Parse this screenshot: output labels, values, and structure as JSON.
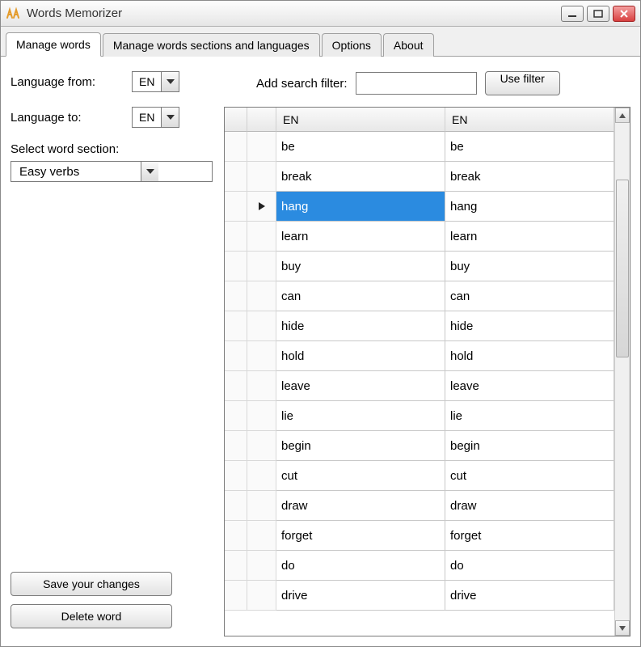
{
  "window": {
    "title": "Words Memorizer"
  },
  "tabs": [
    {
      "label": "Manage words",
      "active": true
    },
    {
      "label": "Manage words sections and languages",
      "active": false
    },
    {
      "label": "Options",
      "active": false
    },
    {
      "label": "About",
      "active": false
    }
  ],
  "left": {
    "language_from_label": "Language from:",
    "language_from_value": "EN",
    "language_to_label": "Language to:",
    "language_to_value": "EN",
    "select_section_label": "Select word section:",
    "section_value": "Easy verbs",
    "save_btn": "Save your changes",
    "delete_btn": "Delete word"
  },
  "filter": {
    "label": "Add search filter:",
    "value": "",
    "use_btn": "Use filter"
  },
  "table": {
    "col_a": "EN",
    "col_b": "EN",
    "selected_index": 2,
    "rows": [
      {
        "a": "be",
        "b": "be"
      },
      {
        "a": "break",
        "b": "break"
      },
      {
        "a": "hang",
        "b": "hang"
      },
      {
        "a": "learn",
        "b": "learn"
      },
      {
        "a": "buy",
        "b": "buy"
      },
      {
        "a": "can",
        "b": "can"
      },
      {
        "a": "hide",
        "b": "hide"
      },
      {
        "a": "hold",
        "b": "hold"
      },
      {
        "a": "leave",
        "b": "leave"
      },
      {
        "a": "lie",
        "b": "lie"
      },
      {
        "a": "begin",
        "b": "begin"
      },
      {
        "a": "cut",
        "b": "cut"
      },
      {
        "a": "draw",
        "b": "draw"
      },
      {
        "a": "forget",
        "b": "forget"
      },
      {
        "a": "do",
        "b": "do"
      },
      {
        "a": "drive",
        "b": "drive"
      }
    ]
  }
}
